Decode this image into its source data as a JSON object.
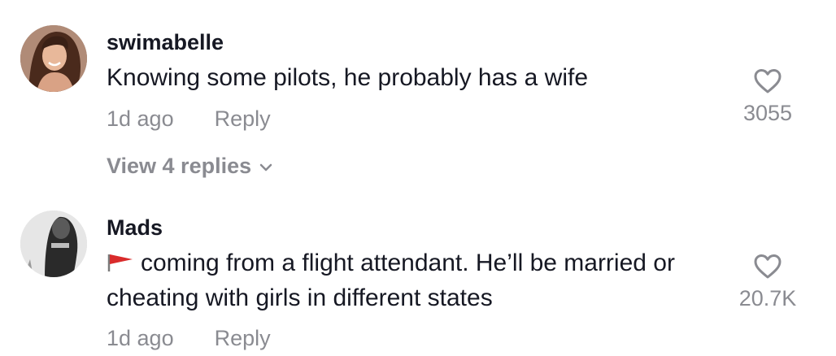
{
  "comments": [
    {
      "username": "swimabelle",
      "text": "Knowing some pilots, he probably has a wife",
      "time": "1d ago",
      "reply_label": "Reply",
      "likes": "3055",
      "view_replies": "View 4 replies",
      "avatar_icon": "user-avatar-photo"
    },
    {
      "username": "Mads",
      "flag_icon": "red-flag-icon",
      "text": "coming from a flight attendant. He’ll be married or cheating with girls in different states",
      "time": "1d ago",
      "reply_label": "Reply",
      "likes": "20.7K",
      "avatar_icon": "user-avatar-photo"
    }
  ],
  "colors": {
    "primary_text": "#161823",
    "secondary_text": "#8a8b91",
    "flag_red": "#d92b2b"
  }
}
